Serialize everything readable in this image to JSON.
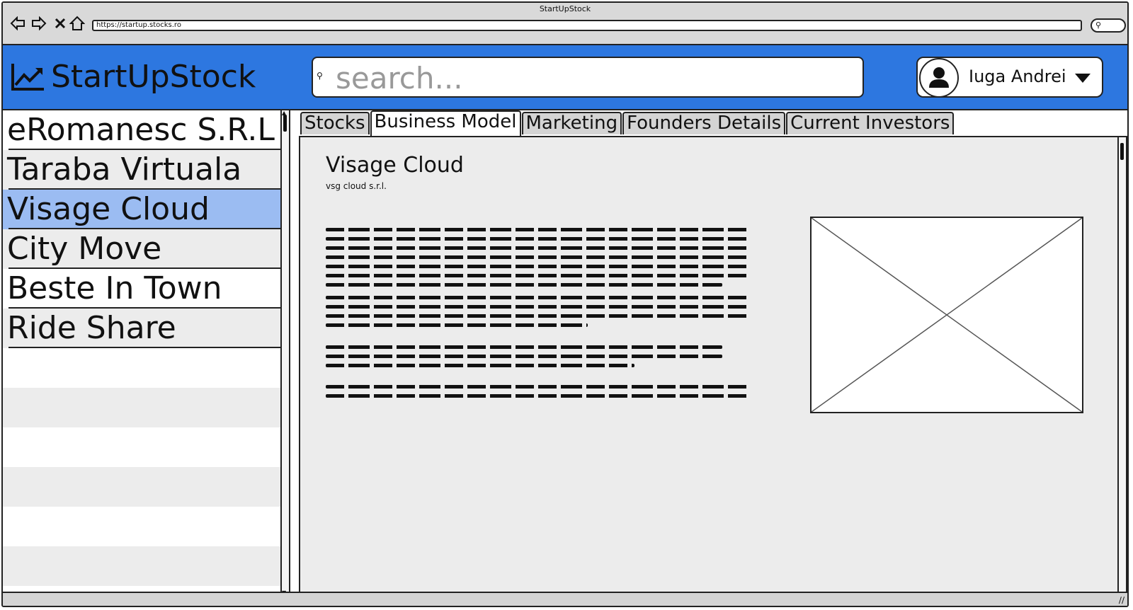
{
  "window": {
    "title": "StartUpStock"
  },
  "browser": {
    "url": "https://startup.stocks.ro",
    "back_icon": "arrow-left-icon",
    "forward_icon": "arrow-right-icon",
    "stop_icon": "close-icon",
    "home_icon": "home-icon"
  },
  "header": {
    "brand": "StartUpStock",
    "search_placeholder": "search...",
    "user_name": "Iuga Andrei",
    "accent_color": "#2d77e0"
  },
  "sidebar": {
    "items": [
      {
        "label": "eRomanesc S.R.L"
      },
      {
        "label": "Taraba Virtuala"
      },
      {
        "label": "Visage Cloud",
        "selected": true
      },
      {
        "label": "City Move"
      },
      {
        "label": "Beste In Town"
      },
      {
        "label": "Ride Share"
      }
    ],
    "selected_color": "#9bbcf2"
  },
  "tabs": [
    {
      "label": "Stocks"
    },
    {
      "label": "Business Model",
      "active": true
    },
    {
      "label": "Marketing"
    },
    {
      "label": "Founders Details"
    },
    {
      "label": "Current Investors"
    }
  ],
  "main": {
    "title": "Visage Cloud",
    "subtitle": "vsg cloud s.r.l."
  }
}
